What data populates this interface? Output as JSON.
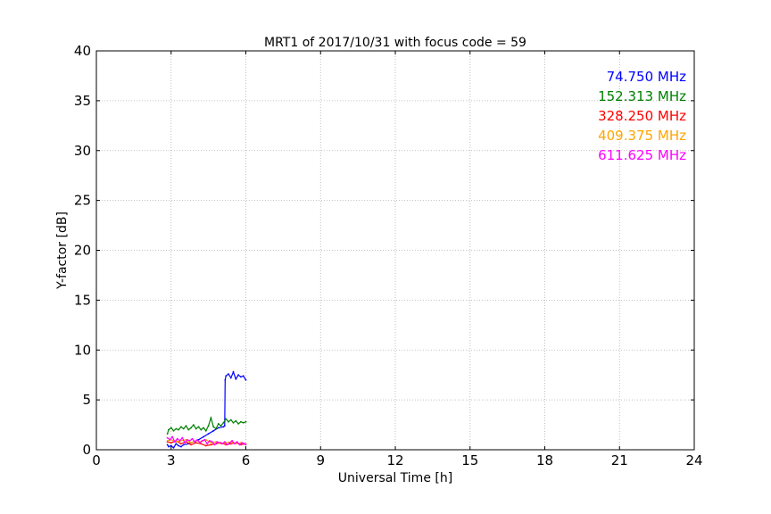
{
  "chart_data": {
    "type": "line",
    "title": "MRT1 of 2017/10/31 with focus code = 59",
    "xlabel": "Universal Time [h]",
    "ylabel": "Y-factor [dB]",
    "xlim": [
      0,
      24
    ],
    "ylim": [
      0,
      40
    ],
    "xticks": [
      0,
      3,
      6,
      9,
      12,
      15,
      18,
      21,
      24
    ],
    "yticks": [
      0,
      5,
      10,
      15,
      20,
      25,
      30,
      35,
      40
    ],
    "grid": true,
    "legend": "top-right",
    "series": [
      {
        "name": "74.750 MHz",
        "color": "#0000ff",
        "x": [
          2.85,
          2.9,
          3.0,
          3.1,
          3.2,
          3.3,
          3.4,
          3.5,
          3.7,
          3.9,
          4.1,
          4.3,
          4.5,
          4.7,
          4.9,
          5.1,
          5.15,
          5.17,
          5.2,
          5.3,
          5.4,
          5.5,
          5.6,
          5.7,
          5.8,
          5.9,
          6.0
        ],
        "y": [
          0.5,
          0.3,
          0.4,
          0.2,
          0.6,
          0.4,
          0.3,
          0.5,
          0.6,
          0.8,
          1.0,
          1.3,
          1.6,
          1.9,
          2.2,
          2.3,
          2.4,
          7.0,
          7.4,
          7.6,
          7.2,
          7.8,
          7.1,
          7.5,
          7.3,
          7.4,
          7.0
        ]
      },
      {
        "name": "152.313 MHz",
        "color": "#008000",
        "x": [
          2.85,
          2.9,
          3.0,
          3.1,
          3.2,
          3.3,
          3.4,
          3.5,
          3.6,
          3.7,
          3.8,
          3.9,
          4.0,
          4.1,
          4.2,
          4.3,
          4.4,
          4.5,
          4.6,
          4.7,
          4.8,
          4.9,
          5.0,
          5.1,
          5.2,
          5.3,
          5.4,
          5.5,
          5.6,
          5.7,
          5.8,
          5.9,
          6.0
        ],
        "y": [
          1.6,
          2.0,
          2.2,
          1.9,
          2.1,
          2.0,
          2.3,
          2.1,
          2.4,
          2.0,
          2.2,
          2.5,
          2.1,
          2.3,
          2.0,
          2.2,
          1.9,
          2.4,
          3.2,
          2.3,
          2.1,
          2.6,
          2.4,
          2.7,
          3.1,
          2.8,
          3.0,
          2.7,
          2.9,
          2.6,
          2.8,
          2.7,
          2.8
        ]
      },
      {
        "name": "328.250 MHz",
        "color": "#ff0000",
        "x": [
          2.85,
          3.0,
          3.2,
          3.4,
          3.6,
          3.8,
          4.0,
          4.2,
          4.4,
          4.6,
          4.8,
          5.0,
          5.2,
          5.4,
          5.6,
          5.8,
          6.0
        ],
        "y": [
          0.8,
          0.7,
          0.9,
          0.6,
          0.8,
          0.5,
          0.7,
          0.6,
          0.4,
          0.5,
          0.6,
          0.7,
          0.5,
          0.6,
          0.7,
          0.5,
          0.6
        ]
      },
      {
        "name": "409.375 MHz",
        "color": "#ffa500",
        "x": [
          2.85,
          3.0,
          3.2,
          3.4,
          3.6,
          3.8,
          4.0,
          4.2,
          4.4,
          4.6,
          4.8,
          5.0,
          5.2,
          5.4,
          5.6,
          5.8,
          6.0
        ],
        "y": [
          0.9,
          1.0,
          0.8,
          0.9,
          1.0,
          0.7,
          0.9,
          0.8,
          1.0,
          0.7,
          0.8,
          0.6,
          0.7,
          0.8,
          0.6,
          0.7,
          0.6
        ]
      },
      {
        "name": "611.625 MHz",
        "color": "#ff00ff",
        "x": [
          2.85,
          2.95,
          3.05,
          3.15,
          3.25,
          3.35,
          3.45,
          3.55,
          3.65,
          3.75,
          3.85,
          3.95,
          4.05,
          4.15,
          4.25,
          4.35,
          4.45,
          4.55,
          4.65,
          4.75,
          4.85,
          4.95,
          5.05,
          5.15,
          5.25,
          5.35,
          5.45,
          5.55,
          5.65,
          5.75,
          5.85,
          5.95,
          6.0
        ],
        "y": [
          1.2,
          1.0,
          1.3,
          0.8,
          1.1,
          0.9,
          1.2,
          0.7,
          1.0,
          0.9,
          1.1,
          0.8,
          1.0,
          0.7,
          0.9,
          1.0,
          0.6,
          0.9,
          0.8,
          0.5,
          0.8,
          0.7,
          0.6,
          0.8,
          0.5,
          0.7,
          0.9,
          0.6,
          0.8,
          0.5,
          0.7,
          0.6,
          0.5
        ]
      }
    ]
  }
}
